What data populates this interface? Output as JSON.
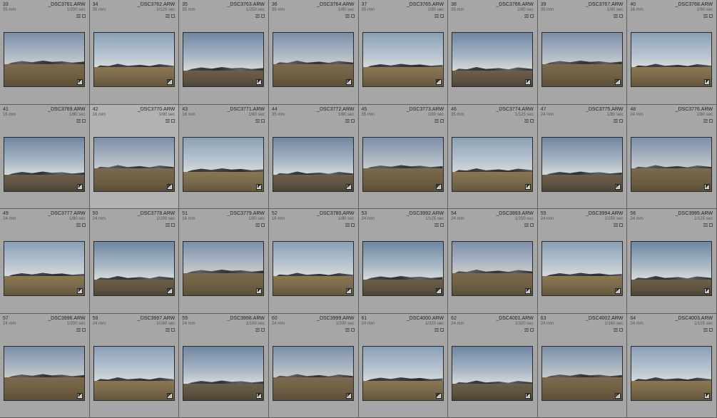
{
  "library": {
    "photos": [
      {
        "index": "33",
        "file": "_DSC3761.ARW",
        "focal": "35 mm",
        "shutter": "1/200 sec"
      },
      {
        "index": "34",
        "file": "_DSC3762.ARW",
        "focal": "35 mm",
        "shutter": "1/125 sec"
      },
      {
        "index": "35",
        "file": "_DSC3763.ARW",
        "focal": "35 mm",
        "shutter": "1/250 sec"
      },
      {
        "index": "36",
        "file": "_DSC3764.ARW",
        "focal": "35 mm",
        "shutter": "1/80 sec"
      },
      {
        "index": "37",
        "file": "_DSC3765.ARW",
        "focal": "35 mm",
        "shutter": "1/80 sec"
      },
      {
        "index": "38",
        "file": "_DSC3766.ARW",
        "focal": "35 mm",
        "shutter": "1/80 sec"
      },
      {
        "index": "39",
        "file": "_DSC3767.ARW",
        "focal": "35 mm",
        "shutter": "1/80 sec"
      },
      {
        "index": "40",
        "file": "_DSC3768.ARW",
        "focal": "16 mm",
        "shutter": "1/80 sec"
      },
      {
        "index": "41",
        "file": "_DSC3769.ARW",
        "focal": "16 mm",
        "shutter": "1/80 sec"
      },
      {
        "index": "42",
        "file": "_DSC3770.ARW",
        "focal": "16 mm",
        "shutter": "1/80 sec"
      },
      {
        "index": "43",
        "file": "_DSC3771.ARW",
        "focal": "16 mm",
        "shutter": "1/80 sec"
      },
      {
        "index": "44",
        "file": "_DSC3772.ARW",
        "focal": "35 mm",
        "shutter": "1/80 sec"
      },
      {
        "index": "45",
        "file": "_DSC3773.ARW",
        "focal": "35 mm",
        "shutter": "1/80 sec"
      },
      {
        "index": "46",
        "file": "_DSC3774.ARW",
        "focal": "35 mm",
        "shutter": "1/125 sec"
      },
      {
        "index": "47",
        "file": "_DSC3775.ARW",
        "focal": "24 mm",
        "shutter": "1/80 sec"
      },
      {
        "index": "48",
        "file": "_DSC3776.ARW",
        "focal": "24 mm",
        "shutter": "1/80 sec"
      },
      {
        "index": "49",
        "file": "_DSC3777.ARW",
        "focal": "24 mm",
        "shutter": "1/80 sec"
      },
      {
        "index": "50",
        "file": "_DSC3778.ARW",
        "focal": "24 mm",
        "shutter": "1/100 sec"
      },
      {
        "index": "51",
        "file": "_DSC3779.ARW",
        "focal": "16 mm",
        "shutter": "1/80 sec"
      },
      {
        "index": "52",
        "file": "_DSC3780.ARW",
        "focal": "16 mm",
        "shutter": "1/80 sec"
      },
      {
        "index": "53",
        "file": "_DSC3992.ARW",
        "focal": "24 mm",
        "shutter": "1/125 sec"
      },
      {
        "index": "54",
        "file": "_DSC3993.ARW",
        "focal": "24 mm",
        "shutter": "1/250 sec"
      },
      {
        "index": "55",
        "file": "_DSC3994.ARW",
        "focal": "24 mm",
        "shutter": "1/250 sec"
      },
      {
        "index": "56",
        "file": "_DSC3995.ARW",
        "focal": "24 mm",
        "shutter": "1/125 sec"
      },
      {
        "index": "57",
        "file": "_DSC3996.ARW",
        "focal": "24 mm",
        "shutter": "1/200 sec"
      },
      {
        "index": "58",
        "file": "_DSC3997.ARW",
        "focal": "24 mm",
        "shutter": "1/160 sec"
      },
      {
        "index": "59",
        "file": "_DSC3998.ARW",
        "focal": "24 mm",
        "shutter": "1/160 sec"
      },
      {
        "index": "60",
        "file": "_DSC3999.ARW",
        "focal": "24 mm",
        "shutter": "1/200 sec"
      },
      {
        "index": "61",
        "file": "_DSC4000.ARW",
        "focal": "24 mm",
        "shutter": "1/320 sec"
      },
      {
        "index": "62",
        "file": "_DSC4001.ARW",
        "focal": "24 mm",
        "shutter": "1/320 sec"
      },
      {
        "index": "63",
        "file": "_DSC4002.ARW",
        "focal": "24 mm",
        "shutter": "1/160 sec"
      },
      {
        "index": "64",
        "file": "_DSC4003.ARW",
        "focal": "24 mm",
        "shutter": "1/125 sec"
      }
    ]
  },
  "colors": {
    "cell": "#a6a6a6",
    "cell_selected": "#b2b2b2",
    "border": "#5f5f5f"
  },
  "icons": {
    "metadata": "metadata-icon",
    "crop": "crop-icon",
    "develop": "develop-adjusted-icon"
  }
}
